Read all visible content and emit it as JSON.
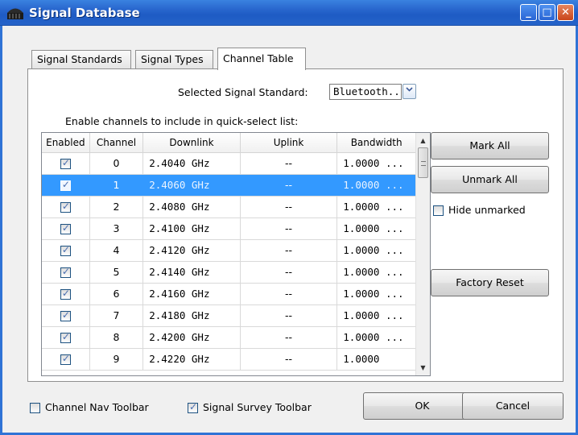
{
  "window": {
    "title": "Signal Database",
    "controls": {
      "minimize": "_",
      "maximize": "□",
      "close": "✕"
    }
  },
  "tabs": [
    {
      "label": "Signal Standards",
      "active": false
    },
    {
      "label": "Signal Types",
      "active": false
    },
    {
      "label": "Channel Table",
      "active": true
    }
  ],
  "standard": {
    "label": "Selected Signal Standard:",
    "value": "Bluetooth...",
    "dropdown_icon": "chevron-down-icon"
  },
  "instruction": "Enable channels to include in quick-select list:",
  "table": {
    "columns": [
      "Enabled",
      "Channel",
      "Downlink",
      "Uplink",
      "Bandwidth"
    ],
    "rows": [
      {
        "enabled": true,
        "channel": "0",
        "downlink": "2.4040 GHz",
        "uplink": "--",
        "bandwidth": "1.0000 ...",
        "selected": false
      },
      {
        "enabled": true,
        "channel": "1",
        "downlink": "2.4060 GHz",
        "uplink": "--",
        "bandwidth": "1.0000 ...",
        "selected": true
      },
      {
        "enabled": true,
        "channel": "2",
        "downlink": "2.4080 GHz",
        "uplink": "--",
        "bandwidth": "1.0000 ...",
        "selected": false
      },
      {
        "enabled": true,
        "channel": "3",
        "downlink": "2.4100 GHz",
        "uplink": "--",
        "bandwidth": "1.0000 ...",
        "selected": false
      },
      {
        "enabled": true,
        "channel": "4",
        "downlink": "2.4120 GHz",
        "uplink": "--",
        "bandwidth": "1.0000 ...",
        "selected": false
      },
      {
        "enabled": true,
        "channel": "5",
        "downlink": "2.4140 GHz",
        "uplink": "--",
        "bandwidth": "1.0000 ...",
        "selected": false
      },
      {
        "enabled": true,
        "channel": "6",
        "downlink": "2.4160 GHz",
        "uplink": "--",
        "bandwidth": "1.0000 ...",
        "selected": false
      },
      {
        "enabled": true,
        "channel": "7",
        "downlink": "2.4180 GHz",
        "uplink": "--",
        "bandwidth": "1.0000 ...",
        "selected": false
      },
      {
        "enabled": true,
        "channel": "8",
        "downlink": "2.4200 GHz",
        "uplink": "--",
        "bandwidth": "1.0000 ...",
        "selected": false
      },
      {
        "enabled": true,
        "channel": "9",
        "downlink": "2.4220 GHz",
        "uplink": "--",
        "bandwidth": "1.0000",
        "selected": false
      }
    ]
  },
  "buttons": {
    "mark_all": "Mark All",
    "unmark_all": "Unmark All",
    "factory_reset": "Factory Reset",
    "ok": "OK",
    "cancel": "Cancel"
  },
  "options": {
    "hide_unmarked": {
      "label": "Hide unmarked",
      "checked": false
    },
    "channel_nav_toolbar": {
      "label": "Channel Nav Toolbar",
      "checked": false
    },
    "signal_survey_toolbar": {
      "label": "Signal Survey Toolbar",
      "checked": true
    }
  },
  "colors": {
    "title_bar": "#2a68cf",
    "selection": "#3399ff",
    "close_button": "#c9451a"
  }
}
